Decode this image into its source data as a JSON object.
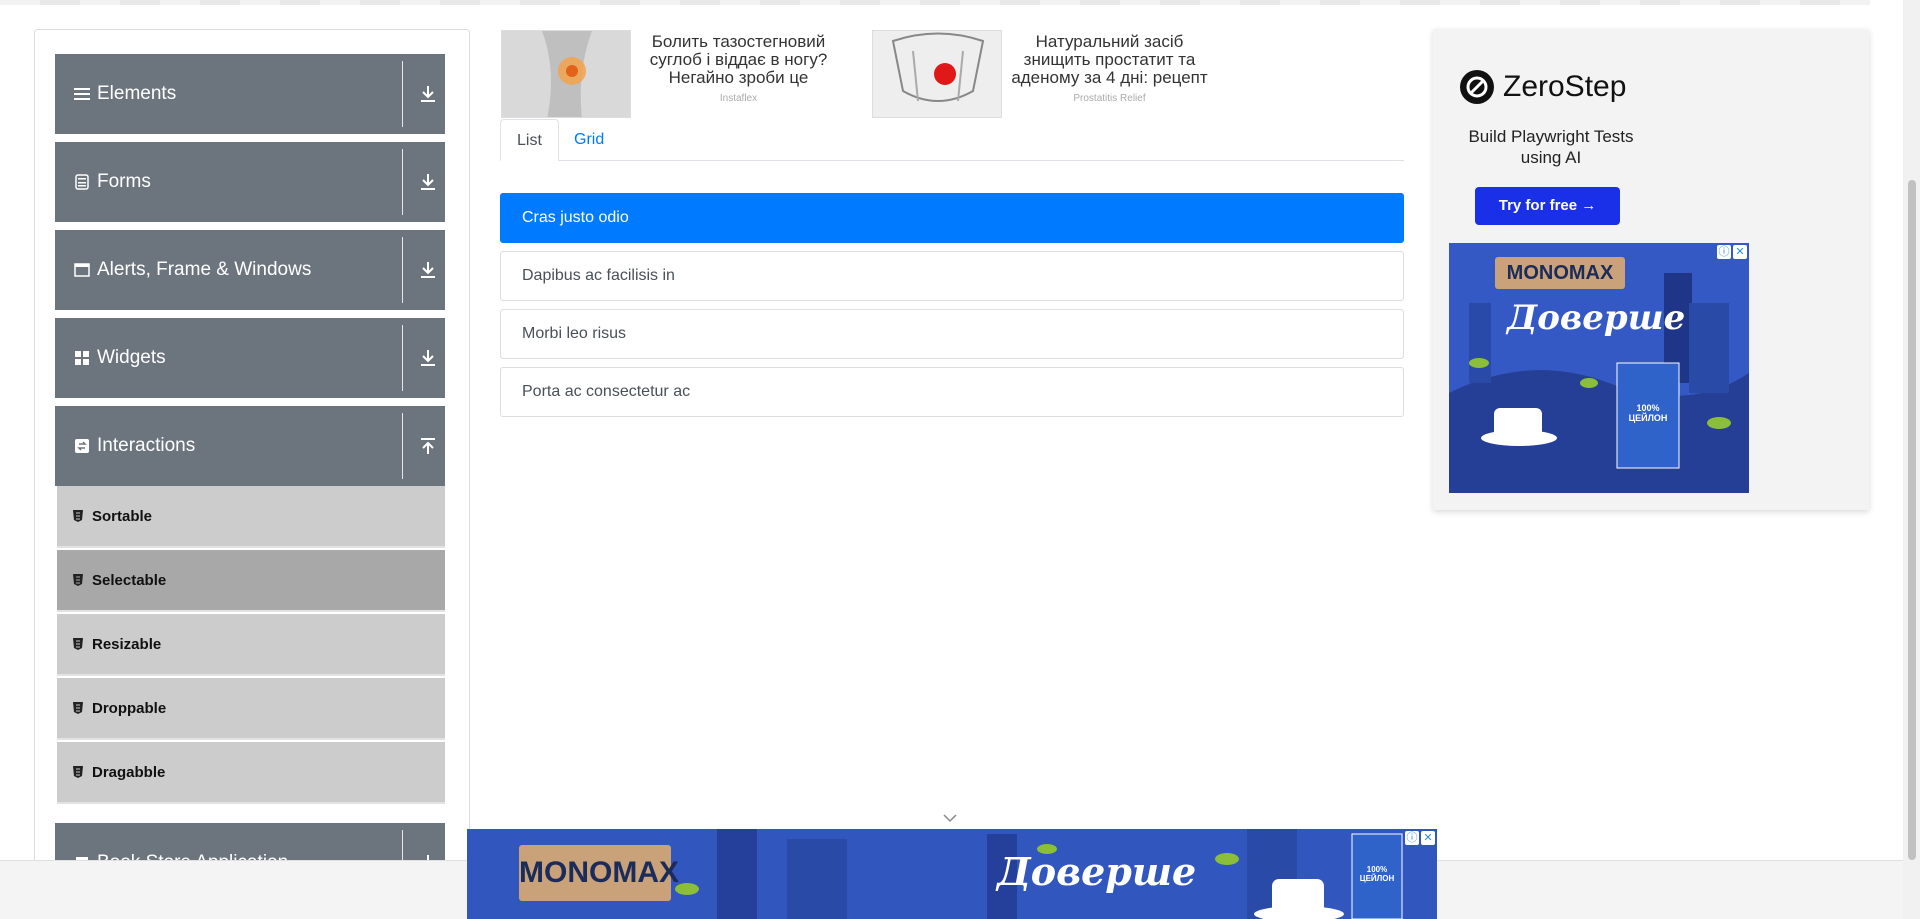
{
  "sidebar": {
    "groups": [
      {
        "label": "Elements",
        "icon": "list-icon",
        "expanded": false
      },
      {
        "label": "Forms",
        "icon": "form-icon",
        "expanded": false
      },
      {
        "label": "Alerts, Frame & Windows",
        "icon": "window-icon",
        "expanded": false
      },
      {
        "label": "Widgets",
        "icon": "widgets-icon",
        "expanded": false
      },
      {
        "label": "Interactions",
        "icon": "interactions-icon",
        "expanded": true
      },
      {
        "label": "Book Store Application",
        "icon": "book-icon",
        "expanded": false
      }
    ],
    "interaction_items": [
      {
        "label": "Sortable",
        "active": false
      },
      {
        "label": "Selectable",
        "active": true
      },
      {
        "label": "Resizable",
        "active": false
      },
      {
        "label": "Droppable",
        "active": false
      },
      {
        "label": "Dragabble",
        "active": false
      }
    ]
  },
  "ads_top": [
    {
      "text": "Болить тазостегновий суглоб і віддає в ногу? Негайно зроби це",
      "source": "Instaflex"
    },
    {
      "text": "Натуральний засіб знищить простатит та аденому за 4 дні: рецепт",
      "source": "Prostatitis Relief"
    }
  ],
  "tabs": [
    {
      "label": "List",
      "active": true
    },
    {
      "label": "Grid",
      "active": false
    }
  ],
  "list_items": [
    {
      "label": "Cras justo odio",
      "selected": true
    },
    {
      "label": "Dapibus ac facilisis in",
      "selected": false
    },
    {
      "label": "Morbi leo risus",
      "selected": false
    },
    {
      "label": "Porta ac consectetur ac",
      "selected": false
    }
  ],
  "ad_right": {
    "brand": "ZeroStep",
    "tagline": "Build Playwright Tests using AI",
    "cta": "Try for free →",
    "banner_brand": "MONOMAX",
    "banner_slogan": "Доверше",
    "banner_pack": "100% ЦЕЙЛОН"
  },
  "bottom_ad": {
    "brand": "MONOMAX",
    "slogan": "Доверше",
    "pack": "100% ЦЕЙЛОН"
  },
  "colors": {
    "sidebar_header": "#6c757d",
    "sub_item": "#cccccc",
    "sub_item_active": "#a8a8a8",
    "accent": "#007bff",
    "zerostep_button": "#1a2fe8"
  }
}
